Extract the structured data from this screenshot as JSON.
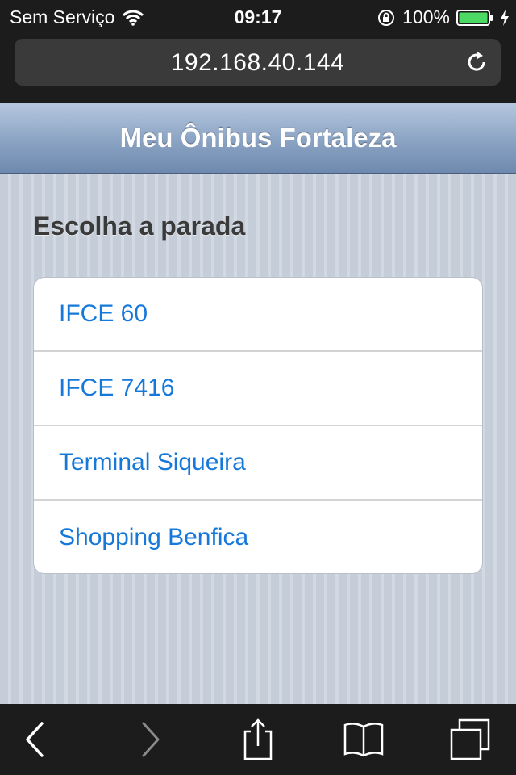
{
  "status_bar": {
    "carrier": "Sem Serviço",
    "time": "09:17",
    "battery": "100%",
    "icons": [
      "wifi-icon",
      "orientation-lock-icon",
      "battery-icon",
      "charging-icon"
    ],
    "battery_color": "#4cd964"
  },
  "browser": {
    "url": "192.168.40.144",
    "icons": [
      "reload-icon"
    ]
  },
  "app": {
    "title": "Meu Ônibus Fortaleza",
    "section_title": "Escolha a parada",
    "stops": [
      "IFCE 60",
      "IFCE 7416",
      "Terminal Siqueira",
      "Shopping Benfica"
    ],
    "link_color": "#1678d9"
  },
  "toolbar": {
    "icons": [
      "back-icon",
      "forward-icon",
      "share-icon",
      "bookmarks-icon",
      "tabs-icon"
    ]
  }
}
